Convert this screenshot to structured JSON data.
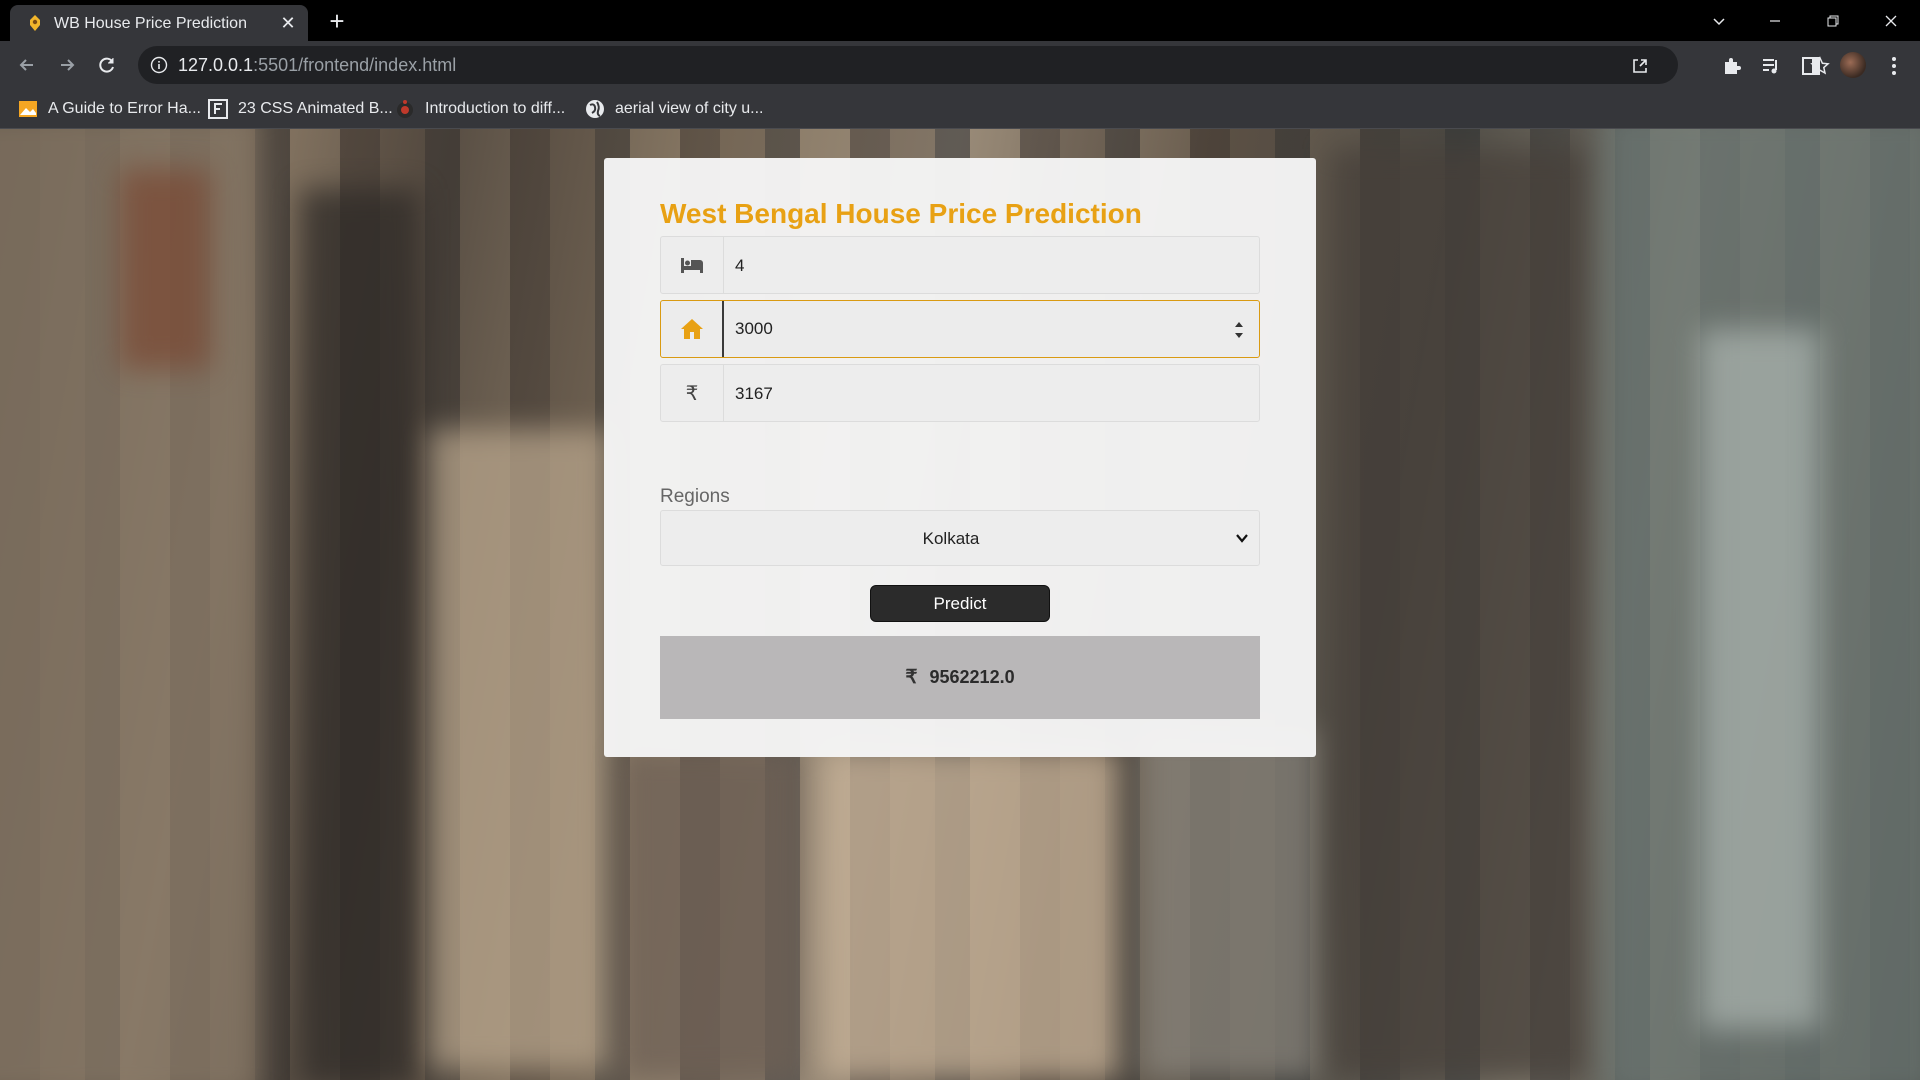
{
  "browser": {
    "tab_title": "WB House Price Prediction",
    "url_host": "127.0.0.1",
    "url_path": ":5501/frontend/index.html",
    "bookmarks": [
      {
        "label": "A Guide to Error Ha...",
        "icon": "image-bookmark-icon"
      },
      {
        "label": "23 CSS Animated B...",
        "icon": "f-logo-icon"
      },
      {
        "label": "Introduction to diff...",
        "icon": "red-dot-logo-icon"
      },
      {
        "label": "aerial view of city u...",
        "icon": "globe-icon"
      }
    ]
  },
  "app": {
    "title": "West Bengal House Price Prediction",
    "title_color": "#e8a114",
    "bedrooms": {
      "icon": "bed-icon",
      "value": "4"
    },
    "area": {
      "icon": "home-icon",
      "value": "3000"
    },
    "price_per_sqft": {
      "icon": "rupee-icon",
      "value": "3167"
    },
    "regions_label": "Regions",
    "region_selected": "Kolkata",
    "predict_label": "Predict",
    "result_symbol": "₹",
    "result_value": "9562212.0"
  }
}
